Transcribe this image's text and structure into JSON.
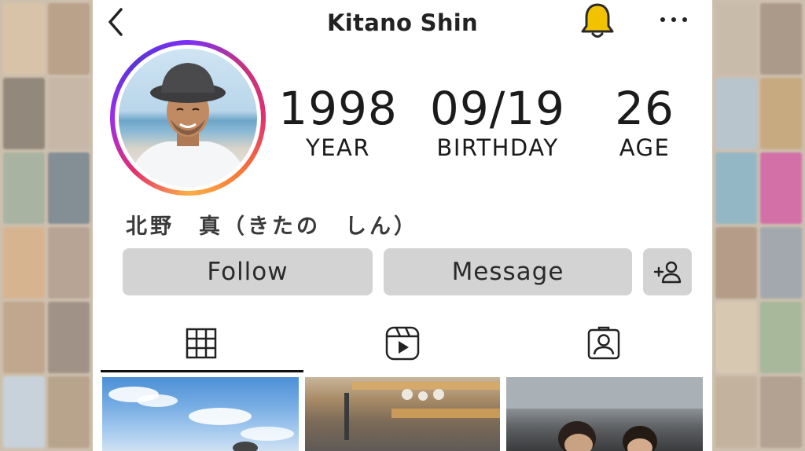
{
  "header": {
    "title": "Kitano Shin",
    "back_icon": "chevron-left-icon",
    "bell_icon": "bell-icon",
    "more_icon": "more-horizontal-icon",
    "bell_color": "#f2c200"
  },
  "profile": {
    "avatar_alt": "profile-photo",
    "stats": [
      {
        "value": "1998",
        "label": "YEAR"
      },
      {
        "value": "09/19",
        "label": "BIRTHDAY"
      },
      {
        "value": "26",
        "label": "AGE"
      }
    ],
    "full_name": "北野　真（きたの　しん）"
  },
  "actions": {
    "follow_label": "Follow",
    "message_label": "Message",
    "add_user_icon": "add-user-icon"
  },
  "tabs": [
    {
      "name": "posts",
      "icon": "grid-icon",
      "active": true
    },
    {
      "name": "reels",
      "icon": "reels-icon",
      "active": false
    },
    {
      "name": "tagged",
      "icon": "tagged-user-icon",
      "active": false
    }
  ],
  "colors": {
    "button_bg": "#d3d3d3",
    "ring_gradient": [
      "#7b2ff7",
      "#e1306c",
      "#fcaf45"
    ]
  }
}
